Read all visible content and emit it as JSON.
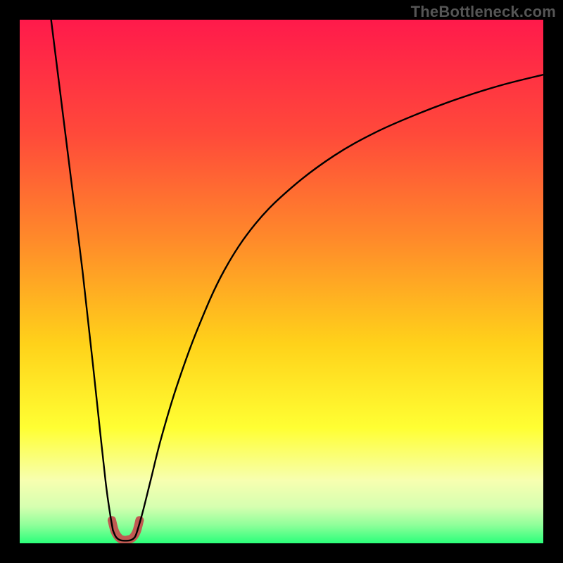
{
  "watermark": "TheBottleneck.com",
  "chart_data": {
    "type": "line",
    "title": "",
    "xlabel": "",
    "ylabel": "",
    "xlim": [
      0,
      100
    ],
    "ylim": [
      0,
      100
    ],
    "gradient_stops": [
      {
        "offset": 0.0,
        "color": "#ff1a4b"
      },
      {
        "offset": 0.22,
        "color": "#ff4a3a"
      },
      {
        "offset": 0.42,
        "color": "#ff8a2a"
      },
      {
        "offset": 0.62,
        "color": "#ffd21a"
      },
      {
        "offset": 0.78,
        "color": "#ffff33"
      },
      {
        "offset": 0.88,
        "color": "#f7ffb0"
      },
      {
        "offset": 0.93,
        "color": "#d6ffb0"
      },
      {
        "offset": 0.965,
        "color": "#8fff9a"
      },
      {
        "offset": 1.0,
        "color": "#2aff7a"
      }
    ],
    "series": [
      {
        "name": "left-branch",
        "x": [
          6.0,
          8.0,
          10.0,
          12.0,
          14.0,
          15.5,
          16.5,
          17.2,
          17.8
        ],
        "values": [
          100,
          84,
          68,
          52,
          34,
          20,
          11,
          6,
          2.5
        ]
      },
      {
        "name": "right-branch",
        "x": [
          22.5,
          23.5,
          25.0,
          27.0,
          30.0,
          34.0,
          39.0,
          45.0,
          52.0,
          60.0,
          68.0,
          76.0,
          84.0,
          92.0,
          100.0
        ],
        "values": [
          2.5,
          6,
          12,
          20,
          30,
          41,
          52,
          61,
          68,
          74,
          78.5,
          82,
          85,
          87.5,
          89.5
        ]
      },
      {
        "name": "valley-cap",
        "x": [
          17.8,
          18.4,
          19.2,
          20.2,
          21.2,
          22.0,
          22.5
        ],
        "values": [
          2.5,
          1.2,
          0.6,
          0.5,
          0.6,
          1.2,
          2.5
        ]
      }
    ],
    "valley_marker": {
      "color": "#c05a52",
      "x": [
        17.6,
        18.2,
        19.0,
        19.6,
        20.1,
        20.7,
        21.5,
        22.3,
        22.9
      ],
      "values": [
        4.4,
        2.2,
        1.0,
        0.7,
        0.6,
        0.7,
        1.0,
        2.2,
        4.4
      ]
    }
  }
}
